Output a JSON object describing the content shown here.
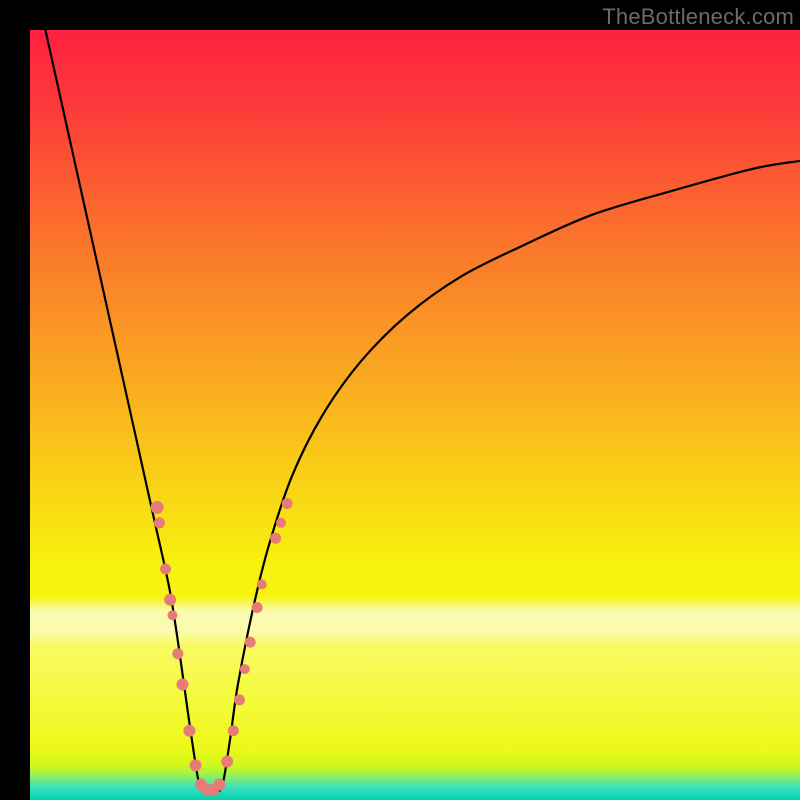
{
  "watermark": "TheBottleneck.com",
  "colors": {
    "frame": "#000000",
    "curve": "#000000",
    "dot_fill": "#e77b76",
    "dot_stroke": "#e77b76",
    "gradient_stops": [
      {
        "offset": 0.0,
        "color": "#fd2140"
      },
      {
        "offset": 0.1,
        "color": "#fd3a3a"
      },
      {
        "offset": 0.22,
        "color": "#fb6330"
      },
      {
        "offset": 0.35,
        "color": "#fa8b27"
      },
      {
        "offset": 0.48,
        "color": "#f9b21e"
      },
      {
        "offset": 0.6,
        "color": "#f8d615"
      },
      {
        "offset": 0.7,
        "color": "#f7f30e"
      },
      {
        "offset": 0.735,
        "color": "#f7f30e"
      },
      {
        "offset": 0.755,
        "color": "#fbfbb0"
      },
      {
        "offset": 0.78,
        "color": "#fbfbb0"
      },
      {
        "offset": 0.8,
        "color": "#f9fa63"
      },
      {
        "offset": 0.93,
        "color": "#eef91a"
      },
      {
        "offset": 0.955,
        "color": "#d0f81c"
      },
      {
        "offset": 0.965,
        "color": "#a6f445"
      },
      {
        "offset": 0.975,
        "color": "#6de988"
      },
      {
        "offset": 0.985,
        "color": "#35dec2"
      },
      {
        "offset": 1.0,
        "color": "#00d4a8"
      }
    ]
  },
  "chart_data": {
    "type": "line",
    "title": "",
    "xlabel": "",
    "ylabel": "",
    "xlim": [
      0,
      100
    ],
    "ylim": [
      0,
      100
    ],
    "grid": false,
    "legend": false,
    "series": [
      {
        "name": "bottleneck-curve",
        "x": [
          2,
          4,
          6,
          8,
          10,
          12,
          14,
          16,
          18,
          19,
          20,
          21,
          22,
          23,
          24,
          25,
          26,
          27,
          29,
          31,
          34,
          38,
          43,
          49,
          56,
          64,
          73,
          83,
          94,
          100
        ],
        "y": [
          100,
          91,
          82,
          73,
          64,
          55,
          46,
          37,
          28,
          22,
          15,
          8,
          2,
          1,
          1,
          2,
          8,
          15,
          25,
          33,
          42,
          50,
          57,
          63,
          68,
          72,
          76,
          79,
          82,
          83
        ]
      }
    ],
    "points": [
      {
        "name": "left-cluster",
        "x": 16.5,
        "y": 38,
        "r": 6.5
      },
      {
        "name": "left-cluster",
        "x": 16.8,
        "y": 36,
        "r": 5.5
      },
      {
        "name": "left-cluster",
        "x": 17.6,
        "y": 30,
        "r": 5.5
      },
      {
        "name": "left-cluster",
        "x": 18.2,
        "y": 26,
        "r": 6.0
      },
      {
        "name": "left-cluster",
        "x": 18.5,
        "y": 24,
        "r": 5.0
      },
      {
        "name": "left-cluster",
        "x": 19.2,
        "y": 19,
        "r": 5.5
      },
      {
        "name": "left-cluster",
        "x": 19.8,
        "y": 15,
        "r": 6.0
      },
      {
        "name": "left-cluster",
        "x": 20.7,
        "y": 9,
        "r": 6.0
      },
      {
        "name": "left-cluster",
        "x": 21.5,
        "y": 4.5,
        "r": 6.0
      },
      {
        "name": "bottom",
        "x": 22.2,
        "y": 2.0,
        "r": 6.0
      },
      {
        "name": "bottom",
        "x": 23.0,
        "y": 1.3,
        "r": 6.0
      },
      {
        "name": "bottom",
        "x": 23.8,
        "y": 1.3,
        "r": 6.0
      },
      {
        "name": "bottom",
        "x": 24.6,
        "y": 2.0,
        "r": 6.0
      },
      {
        "name": "right-cluster",
        "x": 25.6,
        "y": 5.0,
        "r": 6.0
      },
      {
        "name": "right-cluster",
        "x": 26.4,
        "y": 9,
        "r": 5.5
      },
      {
        "name": "right-cluster",
        "x": 27.2,
        "y": 13,
        "r": 5.5
      },
      {
        "name": "right-cluster",
        "x": 27.9,
        "y": 17,
        "r": 5.0
      },
      {
        "name": "right-cluster",
        "x": 28.6,
        "y": 20.5,
        "r": 5.5
      },
      {
        "name": "right-cluster",
        "x": 29.5,
        "y": 25,
        "r": 5.5
      },
      {
        "name": "right-cluster",
        "x": 30.1,
        "y": 28,
        "r": 5.0
      },
      {
        "name": "right-cluster",
        "x": 31.9,
        "y": 34,
        "r": 5.5
      },
      {
        "name": "right-cluster",
        "x": 32.6,
        "y": 36,
        "r": 5.0
      },
      {
        "name": "right-cluster",
        "x": 33.4,
        "y": 38.5,
        "r": 5.5
      }
    ]
  }
}
